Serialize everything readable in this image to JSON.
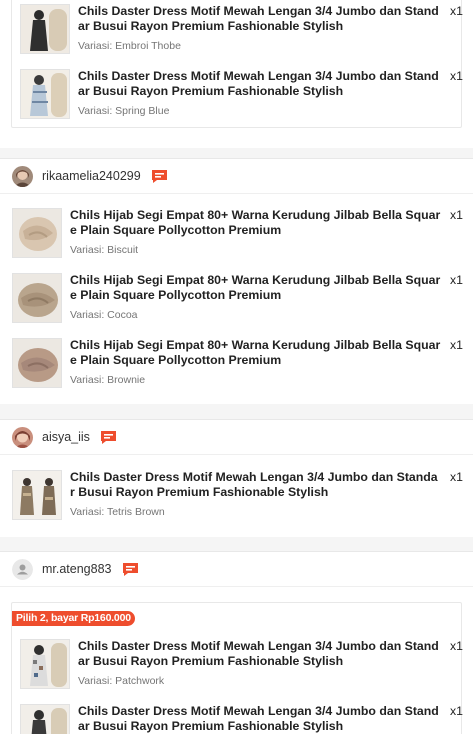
{
  "group0": {
    "items": [
      {
        "title": "Chils Daster Dress Motif Mewah Lengan 3/4 Jumbo dan Standar Busui Rayon Premium Fashionable Stylish",
        "variant": "Variasi: Embroi Thobe",
        "qty": "x1"
      },
      {
        "title": "Chils Daster Dress Motif Mewah Lengan 3/4 Jumbo dan Standar Busui Rayon Premium Fashionable Stylish",
        "variant": "Variasi: Spring Blue",
        "qty": "x1"
      }
    ]
  },
  "group1": {
    "seller": "rikaamelia240299",
    "items": [
      {
        "title": "Chils Hijab Segi Empat 80+ Warna Kerudung Jilbab Bella Square Plain Square Pollycotton Premium",
        "variant": "Variasi: Biscuit",
        "qty": "x1"
      },
      {
        "title": "Chils Hijab Segi Empat 80+ Warna Kerudung Jilbab Bella Square Plain Square Pollycotton Premium",
        "variant": "Variasi: Cocoa",
        "qty": "x1"
      },
      {
        "title": "Chils Hijab Segi Empat 80+ Warna Kerudung Jilbab Bella Square Plain Square Pollycotton Premium",
        "variant": "Variasi: Brownie",
        "qty": "x1"
      }
    ]
  },
  "group2": {
    "seller": "aisya_iis",
    "items": [
      {
        "title": "Chils Daster Dress Motif Mewah Lengan 3/4 Jumbo dan Standar Busui Rayon Premium Fashionable Stylish",
        "variant": "Variasi: Tetris Brown",
        "qty": "x1"
      }
    ]
  },
  "group3": {
    "seller": "mr.ateng883",
    "promo": "Pilih 2, bayar Rp160.000",
    "items": [
      {
        "title": "Chils Daster Dress Motif Mewah Lengan 3/4 Jumbo dan Standar Busui Rayon Premium Fashionable Stylish",
        "variant": "Variasi: Patchwork",
        "qty": "x1"
      },
      {
        "title": "Chils Daster Dress Motif Mewah Lengan 3/4 Jumbo dan Standar Busui Rayon Premium Fashionable Stylish",
        "variant": "",
        "qty": "x1"
      }
    ]
  },
  "icons": {
    "chat": "chat-icon",
    "default_avatar": "user-icon"
  },
  "colors": {
    "accent": "#ee4d2d",
    "background": "#f5f5f5"
  }
}
